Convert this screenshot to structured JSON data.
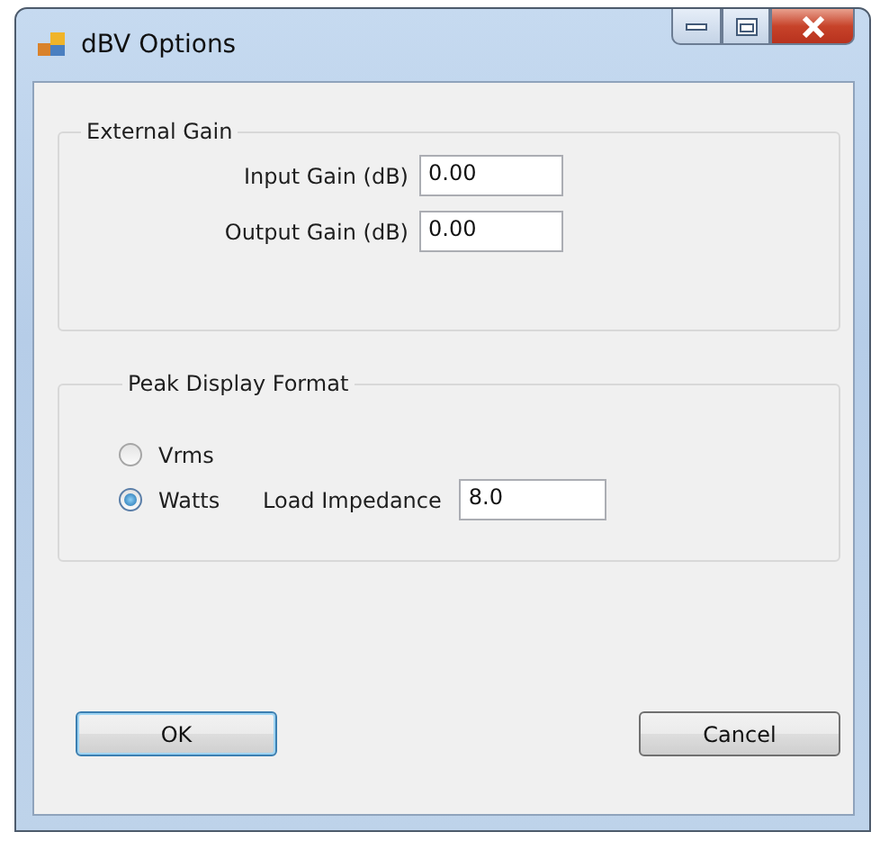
{
  "window": {
    "title": "dBV Options"
  },
  "external_gain": {
    "title": "External Gain",
    "fields": [
      {
        "label": "Input Gain (dB)",
        "value": "0.00"
      },
      {
        "label": "Output Gain (dB)",
        "value": "0.00"
      }
    ]
  },
  "peak_display_format": {
    "title": "Peak Display Format",
    "options": [
      {
        "label": "Vrms",
        "selected": false
      },
      {
        "label": "Watts",
        "selected": true
      }
    ],
    "load_impedance": {
      "label": "Load Impedance",
      "value": "8.0"
    }
  },
  "buttons": [
    {
      "label": "OK",
      "default": true
    },
    {
      "label": "Cancel",
      "default": false
    }
  ]
}
